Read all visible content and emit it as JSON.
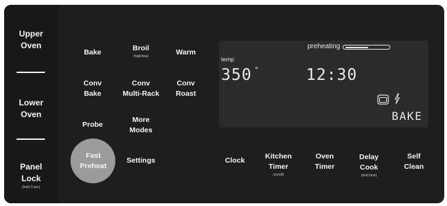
{
  "sidebar": {
    "upper_oven": "Upper\nOven",
    "lower_oven": "Lower\nOven",
    "panel_lock": "Panel\nLock",
    "panel_lock_sub": "(hold 3 sec)"
  },
  "keys": {
    "bake": "Bake",
    "broil": "Broil",
    "broil_sub": "(high/low)",
    "warm": "Warm",
    "conv_bake": "Conv\nBake",
    "conv_multi_rack": "Conv\nMulti-Rack",
    "conv_roast": "Conv\nRoast",
    "probe": "Probe",
    "more_modes": "More\nModes",
    "fast_preheat": "Fast\nPreheat",
    "settings": "Settings",
    "clock": "Clock",
    "kitchen_timer": "Kitchen\nTimer",
    "kitchen_timer_sub": "(on/off)",
    "oven_timer": "Oven\nTimer",
    "delay_cook": "Delay\nCook",
    "delay_cook_sub": "(end time)",
    "self_clean": "Self\nClean"
  },
  "display": {
    "preheating_label": "preheating",
    "preheat_progress": 0.55,
    "temp_label": "temp",
    "temperature": "350",
    "degree": "°",
    "time": "12:30",
    "mode": "BAKE"
  },
  "colors": {
    "panel": "#1e1e21",
    "display_bg": "#2b2b2e",
    "fast_preheat_button": "#9b9b9d",
    "text": "#f4f4f4"
  },
  "icons": [
    "oven-door-icon",
    "lightning-bolt-icon"
  ]
}
